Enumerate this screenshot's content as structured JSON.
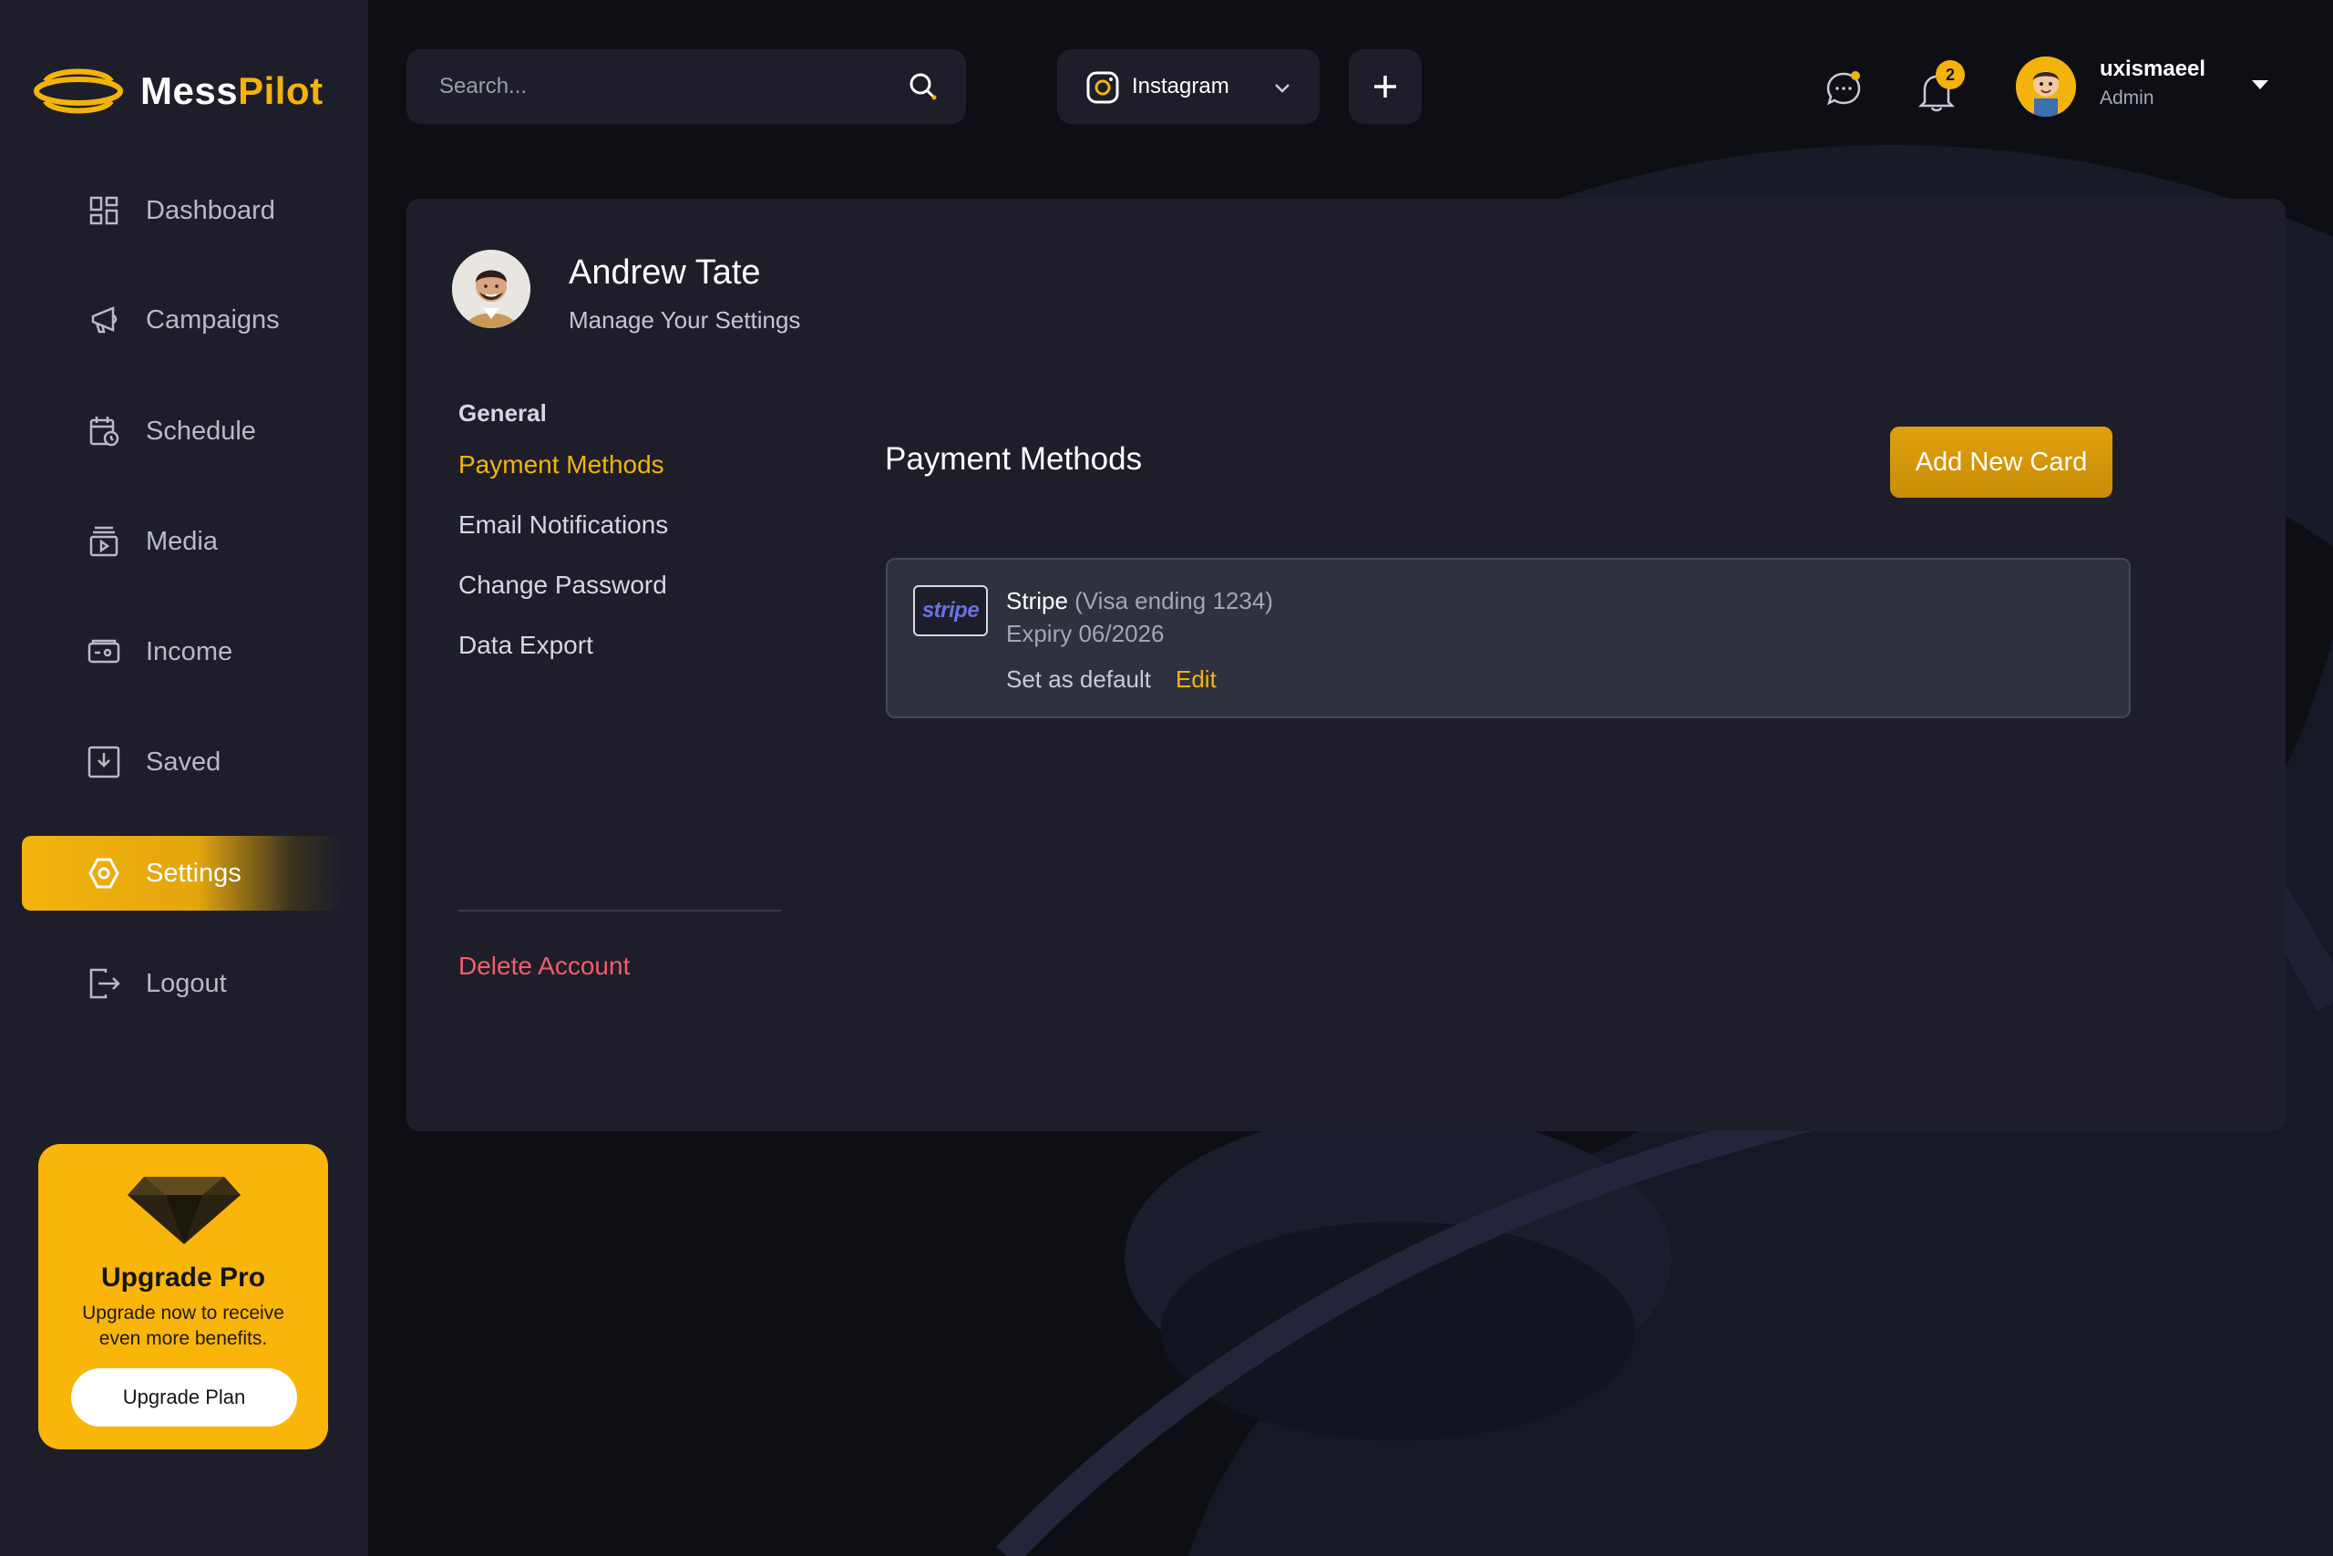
{
  "app": {
    "logo_part1": "Mess",
    "logo_part2": "Pilot",
    "brand_color": "#f4b30c"
  },
  "sidebar": {
    "items": [
      {
        "label": "Dashboard",
        "icon": "dashboard-icon"
      },
      {
        "label": "Campaigns",
        "icon": "megaphone-icon"
      },
      {
        "label": "Schedule",
        "icon": "calendar-clock-icon"
      },
      {
        "label": "Media",
        "icon": "media-icon"
      },
      {
        "label": "Income",
        "icon": "wallet-icon"
      },
      {
        "label": "Saved",
        "icon": "download-icon"
      },
      {
        "label": "Settings",
        "icon": "settings-icon",
        "active": true
      },
      {
        "label": "Logout",
        "icon": "logout-icon"
      }
    ],
    "upgrade": {
      "title": "Upgrade Pro",
      "description": "Upgrade now to receive even more benefits.",
      "button": "Upgrade Plan",
      "icon": "diamond-icon"
    }
  },
  "topbar": {
    "search_placeholder": "Search...",
    "platform": "Instagram",
    "notification_count": "2",
    "user": {
      "name": "uxismaeel",
      "role": "Admin"
    }
  },
  "profile": {
    "name": "Andrew Tate",
    "subtitle": "Manage Your Settings"
  },
  "settings_nav": {
    "heading": "General",
    "links": [
      "Payment Methods",
      "Email Notifications",
      "Change Password",
      "Data Export"
    ],
    "active": "Payment Methods",
    "delete": "Delete Account"
  },
  "payment": {
    "title": "Payment Methods",
    "add_button": "Add New Card",
    "cards": [
      {
        "logo": "stripe",
        "brand": "Stripe",
        "detail": "(Visa ending 1234)",
        "expiry": "Expiry 06/2026",
        "set_default": "Set as default",
        "edit": "Edit"
      }
    ]
  }
}
